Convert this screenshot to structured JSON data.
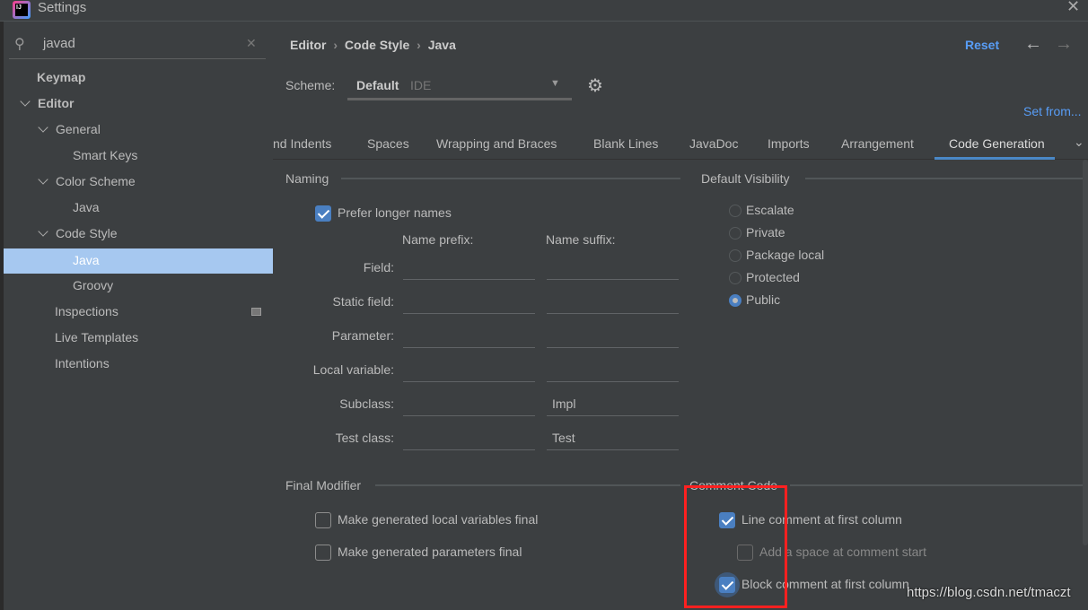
{
  "window": {
    "title": "Settings"
  },
  "search": {
    "value": "javad"
  },
  "sidebar": {
    "items": [
      {
        "label": "Keymap"
      },
      {
        "label": "Editor"
      },
      {
        "label": "General"
      },
      {
        "label": "Smart Keys"
      },
      {
        "label": "Color Scheme"
      },
      {
        "label": "Java"
      },
      {
        "label": "Code Style"
      },
      {
        "label": "Java"
      },
      {
        "label": "Groovy"
      },
      {
        "label": "Inspections"
      },
      {
        "label": "Live Templates"
      },
      {
        "label": "Intentions"
      }
    ]
  },
  "breadcrumb": [
    "Editor",
    "Code Style",
    "Java"
  ],
  "header": {
    "reset": "Reset"
  },
  "scheme": {
    "label": "Scheme:",
    "name": "Default",
    "type": "IDE",
    "set_from": "Set from..."
  },
  "tabs": [
    "nd Indents",
    "Spaces",
    "Wrapping and Braces",
    "Blank Lines",
    "JavaDoc",
    "Imports",
    "Arrangement",
    "Code Generation"
  ],
  "naming": {
    "title": "Naming",
    "prefer_longer": "Prefer longer names",
    "prefer_longer_checked": true,
    "prefix_header": "Name prefix:",
    "suffix_header": "Name suffix:",
    "rows": [
      {
        "label": "Field:",
        "prefix": "",
        "suffix": ""
      },
      {
        "label": "Static field:",
        "prefix": "",
        "suffix": ""
      },
      {
        "label": "Parameter:",
        "prefix": "",
        "suffix": ""
      },
      {
        "label": "Local variable:",
        "prefix": "",
        "suffix": ""
      },
      {
        "label": "Subclass:",
        "prefix": "",
        "suffix": "Impl"
      },
      {
        "label": "Test class:",
        "prefix": "",
        "suffix": "Test"
      }
    ]
  },
  "visibility": {
    "title": "Default Visibility",
    "options": [
      "Escalate",
      "Private",
      "Package local",
      "Protected",
      "Public"
    ],
    "selected": "Public"
  },
  "final_modifier": {
    "title": "Final Modifier",
    "options": [
      {
        "label": "Make generated local variables final",
        "checked": false
      },
      {
        "label": "Make generated parameters final",
        "checked": false
      }
    ]
  },
  "comment_code": {
    "title": "Comment Code",
    "options": [
      {
        "label": "Line comment at first column",
        "checked": true
      },
      {
        "label": "Add a space at comment start",
        "checked": false
      },
      {
        "label": "Block comment at first column",
        "checked": true
      }
    ]
  },
  "watermark": "https://blog.csdn.net/tmaczt",
  "colors": {
    "accent": "#4a88c7",
    "link": "#589df6",
    "selection": "#a6c8f0",
    "highlight_box": "#ff2020"
  }
}
